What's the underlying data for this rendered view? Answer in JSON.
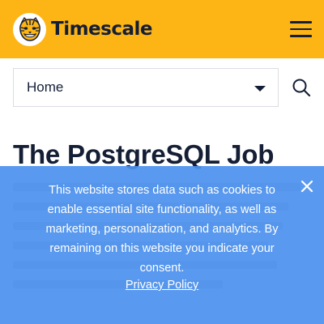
{
  "header": {
    "brand": "Timescale",
    "logo_icon": "tiger-logo-icon",
    "menu_icon": "hamburger-menu-icon",
    "background_color": "#fdb515"
  },
  "nav": {
    "selected": "Home",
    "dropdown_icon": "caret-down-icon",
    "search_icon": "search-icon"
  },
  "main": {
    "title": "The PostgreSQL Job"
  },
  "cookie_banner": {
    "message": "This website stores data such as cookies to enable essential site functionality, as well as marketing, personalization, and analytics. By remaining on this website you indicate your consent.",
    "link_label": "Privacy Policy",
    "close_icon": "close-icon",
    "background_color": "#4c91ee"
  }
}
